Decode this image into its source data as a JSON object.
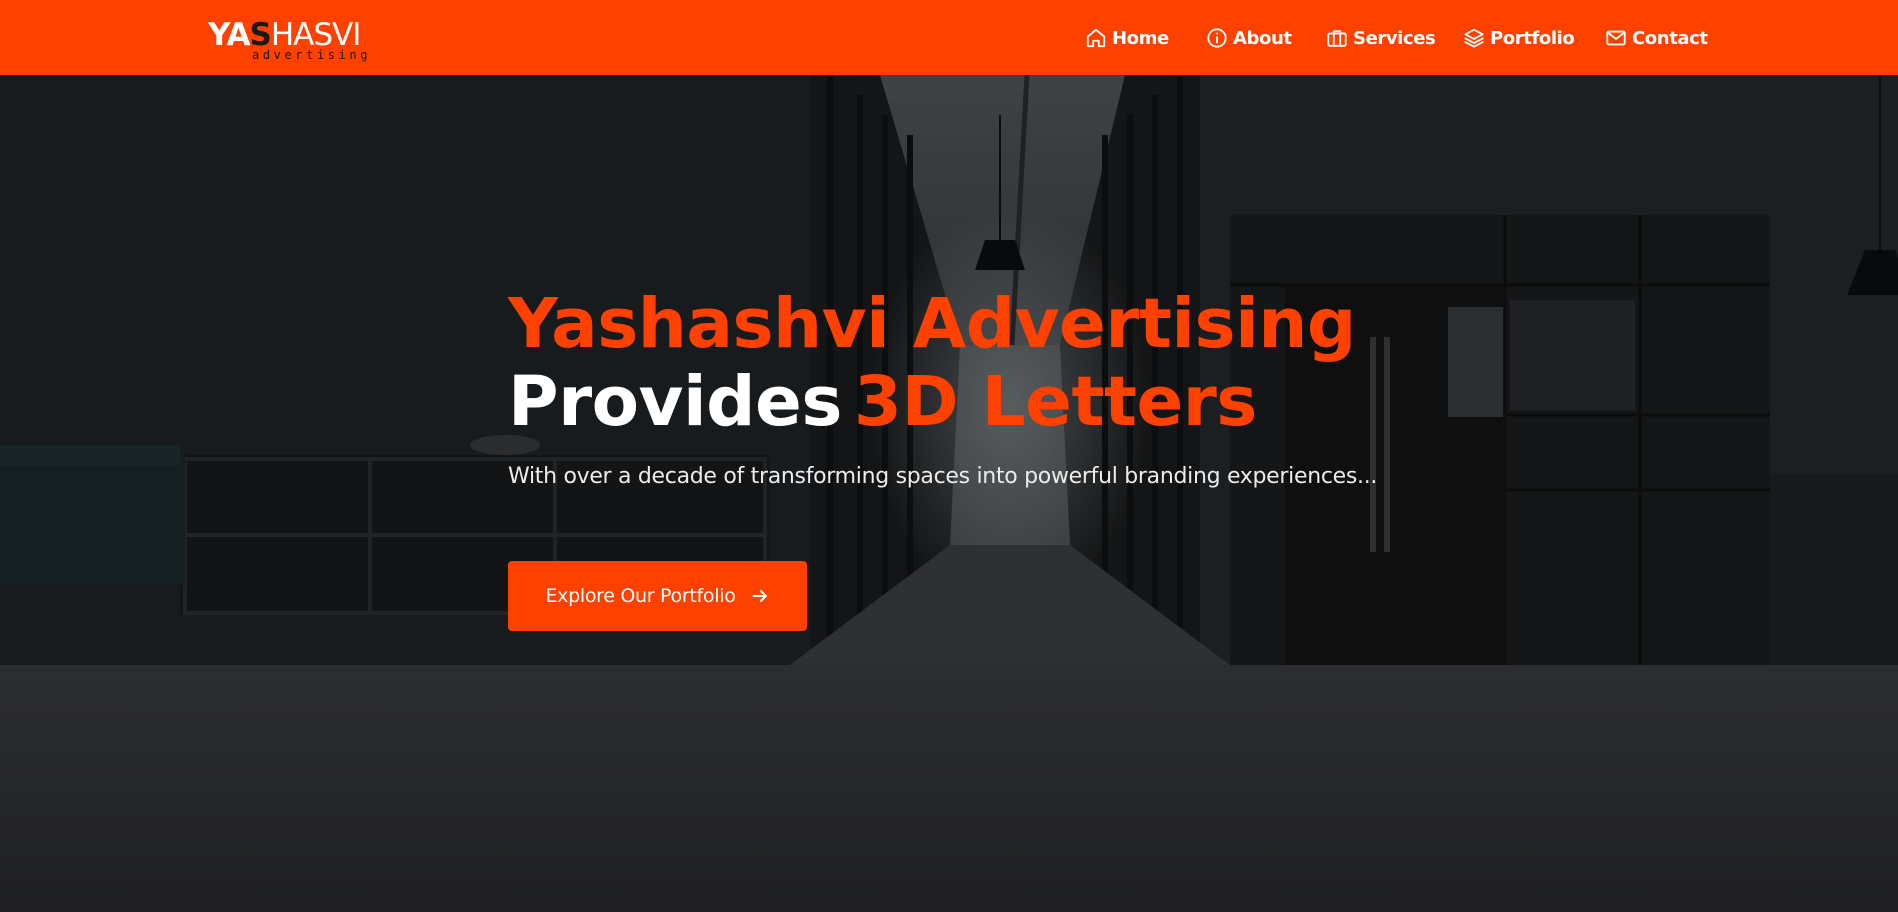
{
  "brand": {
    "logo_part1": "YA",
    "logo_part2": "S",
    "logo_part3": "HASVI",
    "logo_sub": "advertising"
  },
  "nav": {
    "items": [
      {
        "label": "Home",
        "icon": "home-icon"
      },
      {
        "label": "About",
        "icon": "info-icon"
      },
      {
        "label": "Services",
        "icon": "briefcase-icon"
      },
      {
        "label": "Portfolio",
        "icon": "layers-icon"
      },
      {
        "label": "Contact",
        "icon": "mail-icon"
      }
    ]
  },
  "hero": {
    "headline_line1": "Yashashvi Advertising",
    "headline_line2_white": "Provides",
    "headline_line2_accent": "3D Letters",
    "subtitle": "With over a decade of transforming spaces into powerful branding experiences...",
    "cta_label": "Explore Our Portfolio",
    "cta_icon": "arrow-right-icon"
  },
  "colors": {
    "accent": "#ff4100",
    "text_light": "#ffffff",
    "background_dark": "#1f2022"
  }
}
